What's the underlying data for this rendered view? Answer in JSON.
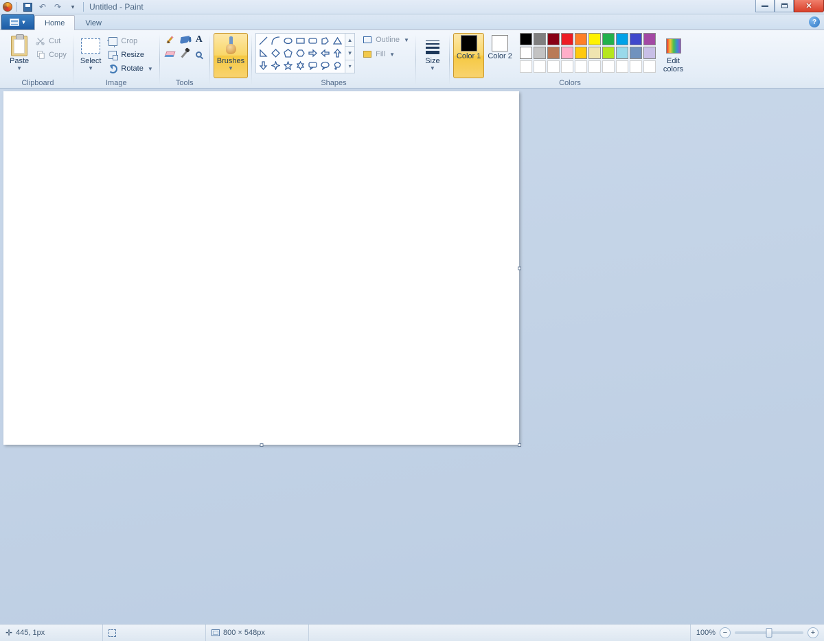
{
  "title": "Untitled - Paint",
  "tabs": {
    "home": "Home",
    "view": "View"
  },
  "groups": {
    "clipboard": "Clipboard",
    "image": "Image",
    "tools": "Tools",
    "shapes": "Shapes",
    "colors": "Colors"
  },
  "clipboard": {
    "paste": "Paste",
    "cut": "Cut",
    "copy": "Copy"
  },
  "image": {
    "select": "Select",
    "crop": "Crop",
    "resize": "Resize",
    "rotate": "Rotate"
  },
  "brushes": "Brushes",
  "shapes": {
    "outline": "Outline",
    "fill": "Fill"
  },
  "size": "Size",
  "color1": "Color\n1",
  "color2": "Color\n2",
  "editcolors": "Edit\ncolors",
  "palette_row1": [
    "#000000",
    "#7f7f7f",
    "#880015",
    "#ed1c24",
    "#ff7f27",
    "#fff200",
    "#22b14c",
    "#00a2e8",
    "#3f48cc",
    "#a349a4"
  ],
  "palette_row2": [
    "#ffffff",
    "#c3c3c3",
    "#b97a57",
    "#ffaec9",
    "#ffc90e",
    "#efe4b0",
    "#b5e61d",
    "#99d9ea",
    "#7092be",
    "#c8bfe7"
  ],
  "status": {
    "pos": "445, 1px",
    "dim": "800 × 548px",
    "zoom": "100%"
  }
}
